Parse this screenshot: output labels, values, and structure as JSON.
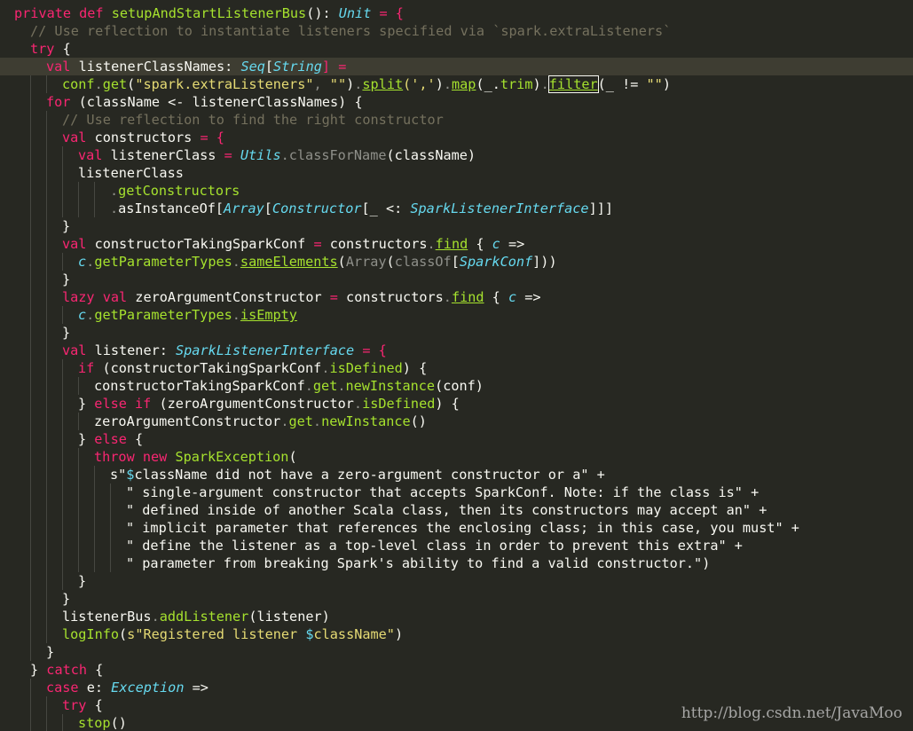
{
  "editor": {
    "language": "scala",
    "theme": "monokai",
    "colors": {
      "background": "#272822",
      "current_line": "#3E3D32",
      "indent_guide": "#464741"
    },
    "current_line_index": 3,
    "lines": [
      {
        "indent": 0,
        "tokens": [
          [
            "private def ",
            "tok-def"
          ],
          [
            "setupAndStartListenerBus",
            "tok-fn"
          ],
          [
            "(): ",
            "tok-punct"
          ],
          [
            "Unit",
            "tok-type"
          ],
          [
            " = {",
            "tok-op"
          ]
        ]
      },
      {
        "indent": 1,
        "tokens": [
          [
            "// Use reflection to instantiate listeners specified via `spark.extraListeners`",
            "tok-comment"
          ]
        ]
      },
      {
        "indent": 1,
        "tokens": [
          [
            "try",
            "tok-kw"
          ],
          [
            " {",
            "tok-punct"
          ]
        ]
      },
      {
        "indent": 2,
        "tokens": [
          [
            "val ",
            "tok-kw"
          ],
          [
            "listenerClassNames: ",
            "tok-id"
          ],
          [
            "Seq",
            "tok-type"
          ],
          [
            "[",
            "tok-punct"
          ],
          [
            "String",
            "tok-type"
          ],
          [
            "] =",
            "tok-op"
          ]
        ]
      },
      {
        "indent": 3,
        "tokens": [
          [
            "conf",
            "tok-fn"
          ],
          [
            ".",
            "tok-dim"
          ],
          [
            "get",
            "tok-fn"
          ],
          [
            "(",
            "tok-punct"
          ],
          [
            "\"spark.extraListeners\"",
            "tok-str"
          ],
          [
            ", ",
            "tok-dim"
          ],
          [
            "\"\"",
            "tok-str"
          ],
          [
            ")",
            "tok-punct"
          ],
          [
            ".",
            "tok-dim"
          ],
          [
            "split",
            "tok-fn tok-underline"
          ],
          [
            "(','",
            "tok-str"
          ],
          [
            ")",
            "tok-punct"
          ],
          [
            ".",
            "tok-dim"
          ],
          [
            "map",
            "tok-fn tok-underline"
          ],
          [
            "(_.",
            "tok-punct"
          ],
          [
            "trim",
            "tok-fn"
          ],
          [
            ")",
            "tok-punct"
          ],
          [
            ".",
            "tok-dim"
          ],
          [
            "filter",
            "tok-fn tok-underline tok-boxed"
          ],
          [
            "(_ != ",
            "tok-punct"
          ],
          [
            "\"\"",
            "tok-str"
          ],
          [
            ")",
            "tok-punct"
          ]
        ]
      },
      {
        "indent": 2,
        "tokens": [
          [
            "for",
            "tok-kw"
          ],
          [
            " (className <- listenerClassNames) {",
            "tok-id"
          ]
        ]
      },
      {
        "indent": 3,
        "tokens": [
          [
            "// Use reflection to find the right constructor",
            "tok-comment"
          ]
        ]
      },
      {
        "indent": 3,
        "tokens": [
          [
            "val ",
            "tok-kw"
          ],
          [
            "constructors",
            "tok-id"
          ],
          [
            " = {",
            "tok-op"
          ]
        ]
      },
      {
        "indent": 4,
        "tokens": [
          [
            "val ",
            "tok-kw"
          ],
          [
            "listenerClass",
            "tok-id"
          ],
          [
            " = ",
            "tok-op"
          ],
          [
            "Utils",
            "tok-type"
          ],
          [
            ".",
            "tok-dim"
          ],
          [
            "classForName",
            "tok-dim"
          ],
          [
            "(className)",
            "tok-id"
          ]
        ]
      },
      {
        "indent": 4,
        "tokens": [
          [
            "listenerClass",
            "tok-id"
          ]
        ]
      },
      {
        "indent": 6,
        "tokens": [
          [
            ".",
            "tok-dim"
          ],
          [
            "getConstructors",
            "tok-fn"
          ]
        ]
      },
      {
        "indent": 6,
        "tokens": [
          [
            ".",
            "tok-dim"
          ],
          [
            "asInstanceOf",
            "tok-id"
          ],
          [
            "[",
            "tok-punct"
          ],
          [
            "Array",
            "tok-type"
          ],
          [
            "[",
            "tok-punct"
          ],
          [
            "Constructor",
            "tok-type"
          ],
          [
            "[_ <: ",
            "tok-punct"
          ],
          [
            "SparkListenerInterface",
            "tok-type"
          ],
          [
            "]]]",
            "tok-punct"
          ]
        ]
      },
      {
        "indent": 3,
        "tokens": [
          [
            "}",
            "tok-punct"
          ]
        ]
      },
      {
        "indent": 3,
        "tokens": [
          [
            "val ",
            "tok-kw"
          ],
          [
            "constructorTakingSparkConf",
            "tok-id"
          ],
          [
            " = ",
            "tok-op"
          ],
          [
            "constructors",
            "tok-id"
          ],
          [
            ".",
            "tok-dim"
          ],
          [
            "find",
            "tok-fn tok-underline"
          ],
          [
            " { ",
            "tok-punct"
          ],
          [
            "c",
            "tok-type"
          ],
          [
            " =>",
            "tok-punct"
          ]
        ]
      },
      {
        "indent": 4,
        "tokens": [
          [
            "c",
            "tok-type"
          ],
          [
            ".",
            "tok-dim"
          ],
          [
            "getParameterTypes",
            "tok-fn"
          ],
          [
            ".",
            "tok-dim"
          ],
          [
            "sameElements",
            "tok-fn tok-underline"
          ],
          [
            "(",
            "tok-punct"
          ],
          [
            "Array",
            "tok-dim"
          ],
          [
            "(",
            "tok-punct"
          ],
          [
            "classOf",
            "tok-dim"
          ],
          [
            "[",
            "tok-punct"
          ],
          [
            "SparkConf",
            "tok-type"
          ],
          [
            "]))",
            "tok-punct"
          ]
        ]
      },
      {
        "indent": 3,
        "tokens": [
          [
            "}",
            "tok-punct"
          ]
        ]
      },
      {
        "indent": 3,
        "tokens": [
          [
            "lazy val ",
            "tok-kw"
          ],
          [
            "zeroArgumentConstructor",
            "tok-id"
          ],
          [
            " = ",
            "tok-op"
          ],
          [
            "constructors",
            "tok-id"
          ],
          [
            ".",
            "tok-dim"
          ],
          [
            "find",
            "tok-fn tok-underline"
          ],
          [
            " { ",
            "tok-punct"
          ],
          [
            "c",
            "tok-type"
          ],
          [
            " =>",
            "tok-punct"
          ]
        ]
      },
      {
        "indent": 4,
        "tokens": [
          [
            "c",
            "tok-type"
          ],
          [
            ".",
            "tok-dim"
          ],
          [
            "getParameterTypes",
            "tok-fn"
          ],
          [
            ".",
            "tok-dim"
          ],
          [
            "isEmpty",
            "tok-fn tok-underline"
          ]
        ]
      },
      {
        "indent": 3,
        "tokens": [
          [
            "}",
            "tok-punct"
          ]
        ]
      },
      {
        "indent": 3,
        "tokens": [
          [
            "val ",
            "tok-kw"
          ],
          [
            "listener: ",
            "tok-id"
          ],
          [
            "SparkListenerInterface",
            "tok-type"
          ],
          [
            " = {",
            "tok-op"
          ]
        ]
      },
      {
        "indent": 4,
        "tokens": [
          [
            "if",
            "tok-kw"
          ],
          [
            " (constructorTakingSparkConf",
            "tok-id"
          ],
          [
            ".",
            "tok-dim"
          ],
          [
            "isDefined",
            "tok-fn"
          ],
          [
            ") {",
            "tok-punct"
          ]
        ]
      },
      {
        "indent": 5,
        "tokens": [
          [
            "constructorTakingSparkConf",
            "tok-id"
          ],
          [
            ".",
            "tok-dim"
          ],
          [
            "get",
            "tok-fn"
          ],
          [
            ".",
            "tok-dim"
          ],
          [
            "newInstance",
            "tok-fn"
          ],
          [
            "(conf)",
            "tok-id"
          ]
        ]
      },
      {
        "indent": 4,
        "tokens": [
          [
            "} ",
            "tok-punct"
          ],
          [
            "else if",
            "tok-kw"
          ],
          [
            " (zeroArgumentConstructor",
            "tok-id"
          ],
          [
            ".",
            "tok-dim"
          ],
          [
            "isDefined",
            "tok-fn"
          ],
          [
            ") {",
            "tok-punct"
          ]
        ]
      },
      {
        "indent": 5,
        "tokens": [
          [
            "zeroArgumentConstructor",
            "tok-id"
          ],
          [
            ".",
            "tok-dim"
          ],
          [
            "get",
            "tok-fn"
          ],
          [
            ".",
            "tok-dim"
          ],
          [
            "newInstance",
            "tok-fn"
          ],
          [
            "()",
            "tok-punct"
          ]
        ]
      },
      {
        "indent": 4,
        "tokens": [
          [
            "} ",
            "tok-punct"
          ],
          [
            "else",
            "tok-kw"
          ],
          [
            " {",
            "tok-punct"
          ]
        ]
      },
      {
        "indent": 5,
        "tokens": [
          [
            "throw new ",
            "tok-kw"
          ],
          [
            "SparkException",
            "tok-fn"
          ],
          [
            "(",
            "tok-punct"
          ]
        ]
      },
      {
        "indent": 6,
        "tokens": [
          [
            "s\"",
            "tok-id"
          ],
          [
            "$",
            "tok-interp"
          ],
          [
            "className did not have a zero-argument constructor or a\"",
            "tok-id"
          ],
          [
            " +",
            "tok-punct"
          ]
        ]
      },
      {
        "indent": 7,
        "tokens": [
          [
            "\" single-argument constructor that accepts SparkConf. Note: if the class is\"",
            "tok-id"
          ],
          [
            " +",
            "tok-punct"
          ]
        ]
      },
      {
        "indent": 7,
        "tokens": [
          [
            "\" defined inside of another Scala class, then its constructors may accept an\"",
            "tok-id"
          ],
          [
            " +",
            "tok-punct"
          ]
        ]
      },
      {
        "indent": 7,
        "tokens": [
          [
            "\" implicit parameter that references the enclosing class; in this case, you must\"",
            "tok-id"
          ],
          [
            " +",
            "tok-punct"
          ]
        ]
      },
      {
        "indent": 7,
        "tokens": [
          [
            "\" define the listener as a top-level class in order to prevent this extra\"",
            "tok-id"
          ],
          [
            " +",
            "tok-punct"
          ]
        ]
      },
      {
        "indent": 7,
        "tokens": [
          [
            "\" parameter from breaking Spark's ability to find a valid constructor.\")",
            "tok-id"
          ]
        ]
      },
      {
        "indent": 4,
        "tokens": [
          [
            "}",
            "tok-punct"
          ]
        ]
      },
      {
        "indent": 3,
        "tokens": [
          [
            "}",
            "tok-punct"
          ]
        ]
      },
      {
        "indent": 3,
        "tokens": [
          [
            "listenerBus",
            "tok-id"
          ],
          [
            ".",
            "tok-dim"
          ],
          [
            "addListener",
            "tok-fn"
          ],
          [
            "(listener)",
            "tok-id"
          ]
        ]
      },
      {
        "indent": 3,
        "tokens": [
          [
            "logInfo",
            "tok-fn"
          ],
          [
            "(",
            "tok-punct"
          ],
          [
            "s\"Registered listener ",
            "tok-str"
          ],
          [
            "$",
            "tok-interp"
          ],
          [
            "className\"",
            "tok-str"
          ],
          [
            ")",
            "tok-punct"
          ]
        ]
      },
      {
        "indent": 2,
        "tokens": [
          [
            "}",
            "tok-punct"
          ]
        ]
      },
      {
        "indent": 1,
        "tokens": [
          [
            "} ",
            "tok-punct"
          ],
          [
            "catch",
            "tok-kw"
          ],
          [
            " {",
            "tok-punct"
          ]
        ]
      },
      {
        "indent": 2,
        "tokens": [
          [
            "case ",
            "tok-kw"
          ],
          [
            "e",
            "tok-id"
          ],
          [
            ": ",
            "tok-punct"
          ],
          [
            "Exception",
            "tok-type"
          ],
          [
            " =>",
            "tok-punct"
          ]
        ]
      },
      {
        "indent": 3,
        "tokens": [
          [
            "try",
            "tok-kw"
          ],
          [
            " {",
            "tok-punct"
          ]
        ]
      },
      {
        "indent": 4,
        "tokens": [
          [
            "stop",
            "tok-fn"
          ],
          [
            "()",
            "tok-punct"
          ]
        ]
      }
    ]
  },
  "watermark": {
    "text": "http://blog.csdn.net/JavaMoo"
  }
}
